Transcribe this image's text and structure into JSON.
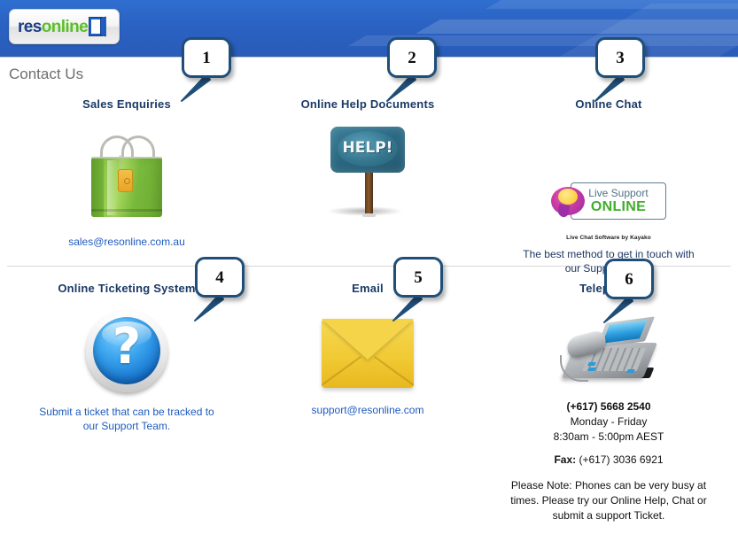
{
  "header": {
    "logo": {
      "part1": "res",
      "part2": "online",
      "door_icon": "door-icon"
    }
  },
  "page_title": "Contact Us",
  "callouts": [
    {
      "number": "1"
    },
    {
      "number": "2"
    },
    {
      "number": "3"
    },
    {
      "number": "4"
    },
    {
      "number": "5"
    },
    {
      "number": "6"
    }
  ],
  "sections": {
    "sales": {
      "title": "Sales Enquiries",
      "icon": "shopping-bag-icon",
      "email": "sales@resonline.com.au"
    },
    "help_docs": {
      "title": "Online Help Documents",
      "icon": "help-sign-icon",
      "sign_text": "HELP!"
    },
    "online_chat": {
      "title": "Online Chat",
      "icon": "live-chat-badge-icon",
      "badge_line1": "Live Support",
      "badge_line2": "ONLINE",
      "attribution": "Live Chat Software by Kayako",
      "description": "The best method to get in touch with our Support Team."
    },
    "ticketing": {
      "title": "Online Ticketing System",
      "icon": "question-mark-icon",
      "description": "Submit a ticket that can be tracked to our Support Team."
    },
    "email": {
      "title": "Email",
      "icon": "envelope-icon",
      "address": "support@resonline.com"
    },
    "telephone": {
      "title": "Telephone",
      "icon": "desk-phone-icon",
      "number": "(+617) 5668 2540",
      "days": "Monday - Friday",
      "hours": "8:30am - 5:00pm AEST",
      "fax_label": "Fax:",
      "fax_number": " (+617) 3036 6921",
      "note_label": "Please Note:",
      "note_text": " Phones can be very busy at times.  Please try our Online Help, Chat or submit a support Ticket."
    }
  },
  "colors": {
    "banner_blue": "#2b64c4",
    "heading_navy": "#1a3a66",
    "link_blue": "#1f5bbf",
    "callout_border": "#1f4e79",
    "title_gray": "#6e6e6e",
    "logo_green": "#5cbf2a"
  }
}
